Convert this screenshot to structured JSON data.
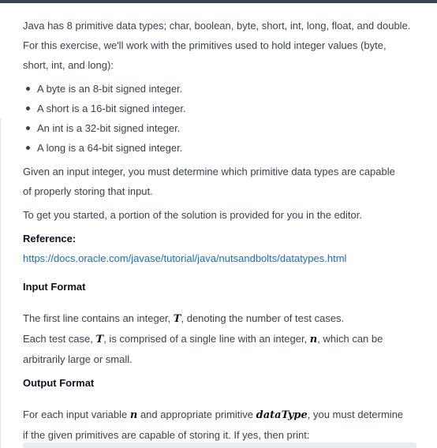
{
  "intro": {
    "line1": "Java has 8 primitive data types; char, boolean, byte, short, int, long, float, and double.",
    "line2": "For this exercise, we'll work with the primitives used to hold integer values (byte,",
    "line3": "short, int, and long):"
  },
  "bullets": [
    "A byte is an 8-bit signed integer.",
    "A short is a 16-bit signed integer.",
    "An int is a 32-bit signed integer.",
    "A long is a 64-bit signed integer."
  ],
  "given": {
    "line1": "Given an input integer, you must determine which primitive data types are capable",
    "line2": "of properly storing that input."
  },
  "started": "To get you started, a portion of the solution is provided for you in the editor.",
  "reference": {
    "label": "Reference:",
    "url": "https://docs.oracle.com/javase/tutorial/java/nutsandbolts/datatypes.html"
  },
  "input_format": {
    "heading": "Input Format",
    "line1_a": "The first line contains an integer,",
    "line1_var": "T",
    "line1_b": ", denoting the number of test cases.",
    "line2_a": "Each test case,",
    "line2_var": "T",
    "line2_b": ", is comprised of a single line with an integer,",
    "line2_var2": "n",
    "line2_c": ", which can be",
    "line3": "arbitrarily large or small."
  },
  "output_format": {
    "heading": "Output Format",
    "line1_a": "For each input variable",
    "line1_var": "n",
    "line1_b": "and appropriate primitive",
    "line1_var2": "dataType",
    "line1_c": ", you must determine",
    "line2": "if the given primitives are capable of storing it. If yes, then print:"
  }
}
